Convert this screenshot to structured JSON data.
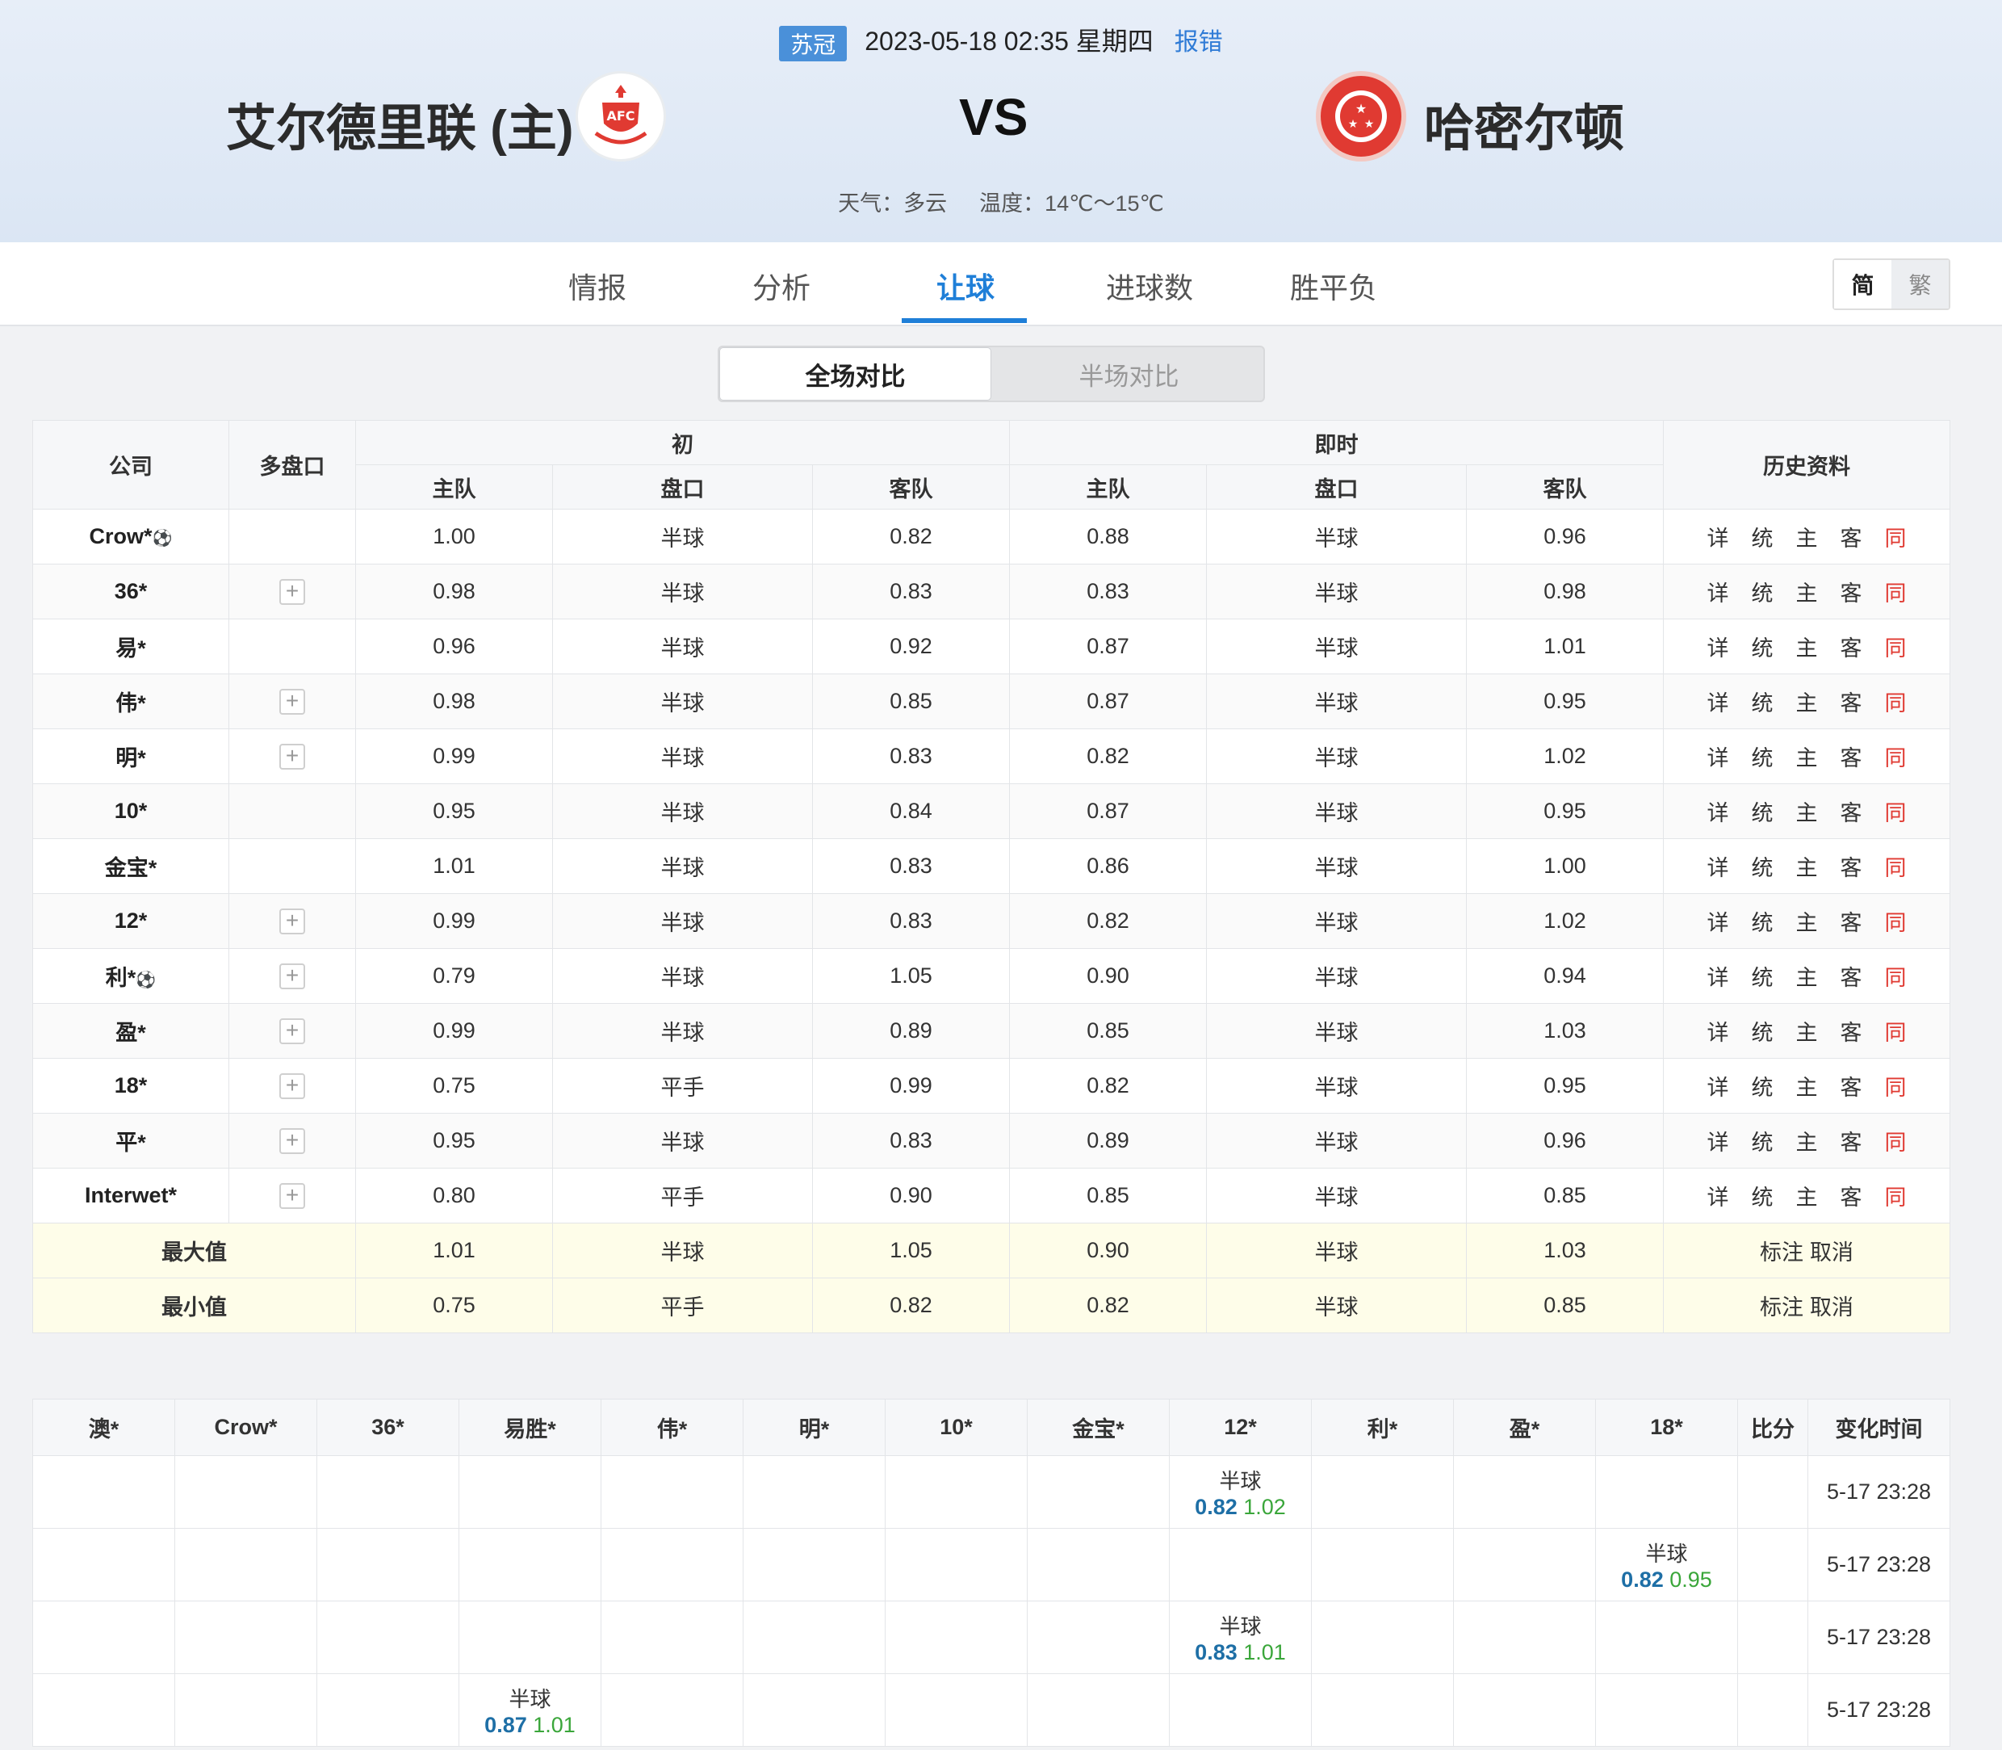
{
  "match": {
    "league": "苏冠",
    "datetime": "2023-05-18 02:35 星期四",
    "report": "报错",
    "home": "艾尔德里联 (主)",
    "away": "哈密尔顿",
    "vs": "VS",
    "weather": "天气：多云",
    "temperature": "温度：14℃～15℃"
  },
  "tabs": [
    "情报",
    "分析",
    "让球",
    "进球数",
    "胜平负"
  ],
  "active_tab": "让球",
  "lang": {
    "simplified": "简",
    "traditional": "繁"
  },
  "segment": {
    "full": "全场对比",
    "half": "半场对比"
  },
  "odds_table": {
    "headers": {
      "company": "公司",
      "multi": "多盘口",
      "initial": "初",
      "live": "即时",
      "history": "历史资料",
      "home": "主队",
      "line": "盘口",
      "away": "客队"
    },
    "history_links": [
      "详",
      "统",
      "主",
      "客",
      "同"
    ],
    "rows": [
      {
        "company": "Crow*",
        "ball": true,
        "plus": false,
        "i_home": "1.00",
        "i_line": "半球",
        "i_away": "0.82",
        "l_home": "0.88",
        "l_line": "半球",
        "l_away": "0.96"
      },
      {
        "company": "36*",
        "ball": false,
        "plus": true,
        "i_home": "0.98",
        "i_line": "半球",
        "i_away": "0.83",
        "l_home": "0.83",
        "l_line": "半球",
        "l_away": "0.98"
      },
      {
        "company": "易*",
        "ball": false,
        "plus": false,
        "i_home": "0.96",
        "i_line": "半球",
        "i_away": "0.92",
        "l_home": "0.87",
        "l_line": "半球",
        "l_away": "1.01"
      },
      {
        "company": "伟*",
        "ball": false,
        "plus": true,
        "i_home": "0.98",
        "i_line": "半球",
        "i_away": "0.85",
        "l_home": "0.87",
        "l_line": "半球",
        "l_away": "0.95"
      },
      {
        "company": "明*",
        "ball": false,
        "plus": true,
        "i_home": "0.99",
        "i_line": "半球",
        "i_away": "0.83",
        "l_home": "0.82",
        "l_line": "半球",
        "l_away": "1.02"
      },
      {
        "company": "10*",
        "ball": false,
        "plus": false,
        "i_home": "0.95",
        "i_line": "半球",
        "i_away": "0.84",
        "l_home": "0.87",
        "l_line": "半球",
        "l_away": "0.95"
      },
      {
        "company": "金宝*",
        "ball": false,
        "plus": false,
        "i_home": "1.01",
        "i_line": "半球",
        "i_away": "0.83",
        "l_home": "0.86",
        "l_line": "半球",
        "l_away": "1.00"
      },
      {
        "company": "12*",
        "ball": false,
        "plus": true,
        "i_home": "0.99",
        "i_line": "半球",
        "i_away": "0.83",
        "l_home": "0.82",
        "l_line": "半球",
        "l_away": "1.02"
      },
      {
        "company": "利*",
        "ball": true,
        "plus": true,
        "i_home": "0.79",
        "i_line": "半球",
        "i_away": "1.05",
        "l_home": "0.90",
        "l_line": "半球",
        "l_away": "0.94"
      },
      {
        "company": "盈*",
        "ball": false,
        "plus": true,
        "i_home": "0.99",
        "i_line": "半球",
        "i_away": "0.89",
        "l_home": "0.85",
        "l_line": "半球",
        "l_away": "1.03"
      },
      {
        "company": "18*",
        "ball": false,
        "plus": true,
        "i_home": "0.75",
        "i_line": "平手",
        "i_away": "0.99",
        "l_home": "0.82",
        "l_line": "半球",
        "l_away": "0.95"
      },
      {
        "company": "平*",
        "ball": false,
        "plus": true,
        "i_home": "0.95",
        "i_line": "半球",
        "i_away": "0.83",
        "l_home": "0.89",
        "l_line": "半球",
        "l_away": "0.96"
      },
      {
        "company": "Interwet*",
        "ball": false,
        "plus": true,
        "i_home": "0.80",
        "i_line": "平手",
        "i_away": "0.90",
        "l_home": "0.85",
        "l_line": "半球",
        "l_away": "0.85"
      }
    ],
    "stats": [
      {
        "label": "最大值",
        "i_home": "1.01",
        "i_line": "半球",
        "i_away": "1.05",
        "l_home": "0.90",
        "l_line": "半球",
        "l_away": "1.03",
        "mark": "标注",
        "cancel": "取消"
      },
      {
        "label": "最小值",
        "i_home": "0.75",
        "i_line": "平手",
        "i_away": "0.82",
        "l_home": "0.82",
        "l_line": "半球",
        "l_away": "0.85",
        "mark": "标注",
        "cancel": "取消"
      }
    ]
  },
  "change_table": {
    "columns": [
      "澳*",
      "Crow*",
      "36*",
      "易胜*",
      "伟*",
      "明*",
      "10*",
      "金宝*",
      "12*",
      "利*",
      "盈*",
      "18*",
      "比分",
      "变化时间"
    ],
    "rows": [
      {
        "col": 8,
        "line": "半球",
        "home": "0.82",
        "away": "1.02",
        "time": "5-17 23:28"
      },
      {
        "col": 11,
        "line": "半球",
        "home": "0.82",
        "away": "0.95",
        "time": "5-17 23:28"
      },
      {
        "col": 8,
        "line": "半球",
        "home": "0.83",
        "away": "1.01",
        "time": "5-17 23:28"
      },
      {
        "col": 3,
        "line": "半球",
        "home": "0.87",
        "away": "1.01",
        "time": "5-17 23:28"
      }
    ]
  },
  "colors": {
    "accent": "#1f7fd8",
    "same_link": "#e03a32",
    "change_home": "#1e6fa6",
    "change_away": "#3aa63a",
    "stat_row_bg": "#fefde9"
  }
}
